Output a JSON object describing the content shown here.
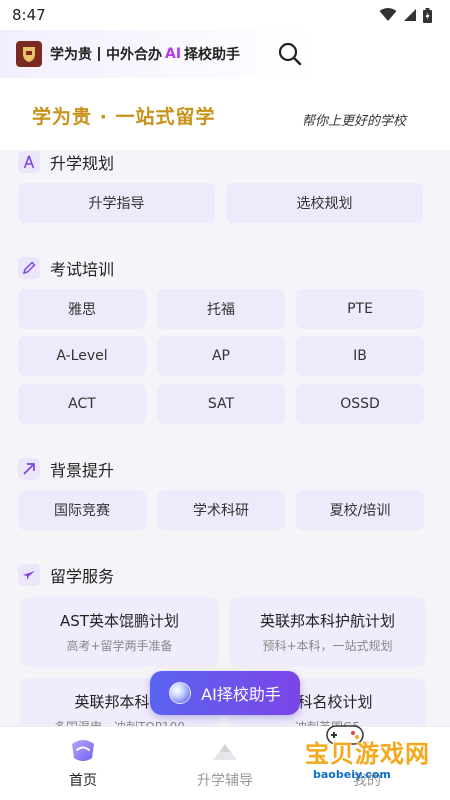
{
  "status_bar": {
    "time": "8:47"
  },
  "header": {
    "brand": "学为贵",
    "subtitle_pre": "中外合办",
    "subtitle_ai": "AI",
    "subtitle_post": "择校助手"
  },
  "banner": {
    "title": "学为贵 · 一站式留学",
    "slogan": "帮你上更好的学校"
  },
  "sections": {
    "planning": {
      "title": "升学规划",
      "chips": [
        "升学指导",
        "选校规划"
      ]
    },
    "exams": {
      "title": "考试培训",
      "chips": [
        "雅思",
        "托福",
        "PTE",
        "A-Level",
        "AP",
        "IB",
        "ACT",
        "SAT",
        "OSSD"
      ]
    },
    "background": {
      "title": "背景提升",
      "chips": [
        "国际竞赛",
        "学术科研",
        "夏校/培训"
      ]
    },
    "services": {
      "title": "留学服务",
      "cards": [
        {
          "title": "AST英本馄鹏计划",
          "sub": "高考+留学两手准备"
        },
        {
          "title": "英联邦本科护航计划",
          "sub": "预科+本科，一站式规划"
        },
        {
          "title": "英联邦本科留",
          "sub": "多国混申，冲刺TOP100"
        },
        {
          "title": "本科名校计划",
          "sub": "冲刺英国G5"
        }
      ]
    }
  },
  "ai_button": {
    "label": "AI择校助手"
  },
  "tabs": [
    {
      "label": "首页",
      "active": true
    },
    {
      "label": "升学辅导",
      "active": false
    },
    {
      "label": "我的",
      "active": false
    }
  ],
  "watermark": {
    "text": "宝贝游戏网",
    "url": "baobeiy.com"
  },
  "colors": {
    "brand_gold": "#c99117",
    "accent_purple": "#7b45e8",
    "chip_bg": "#eeeafb"
  }
}
